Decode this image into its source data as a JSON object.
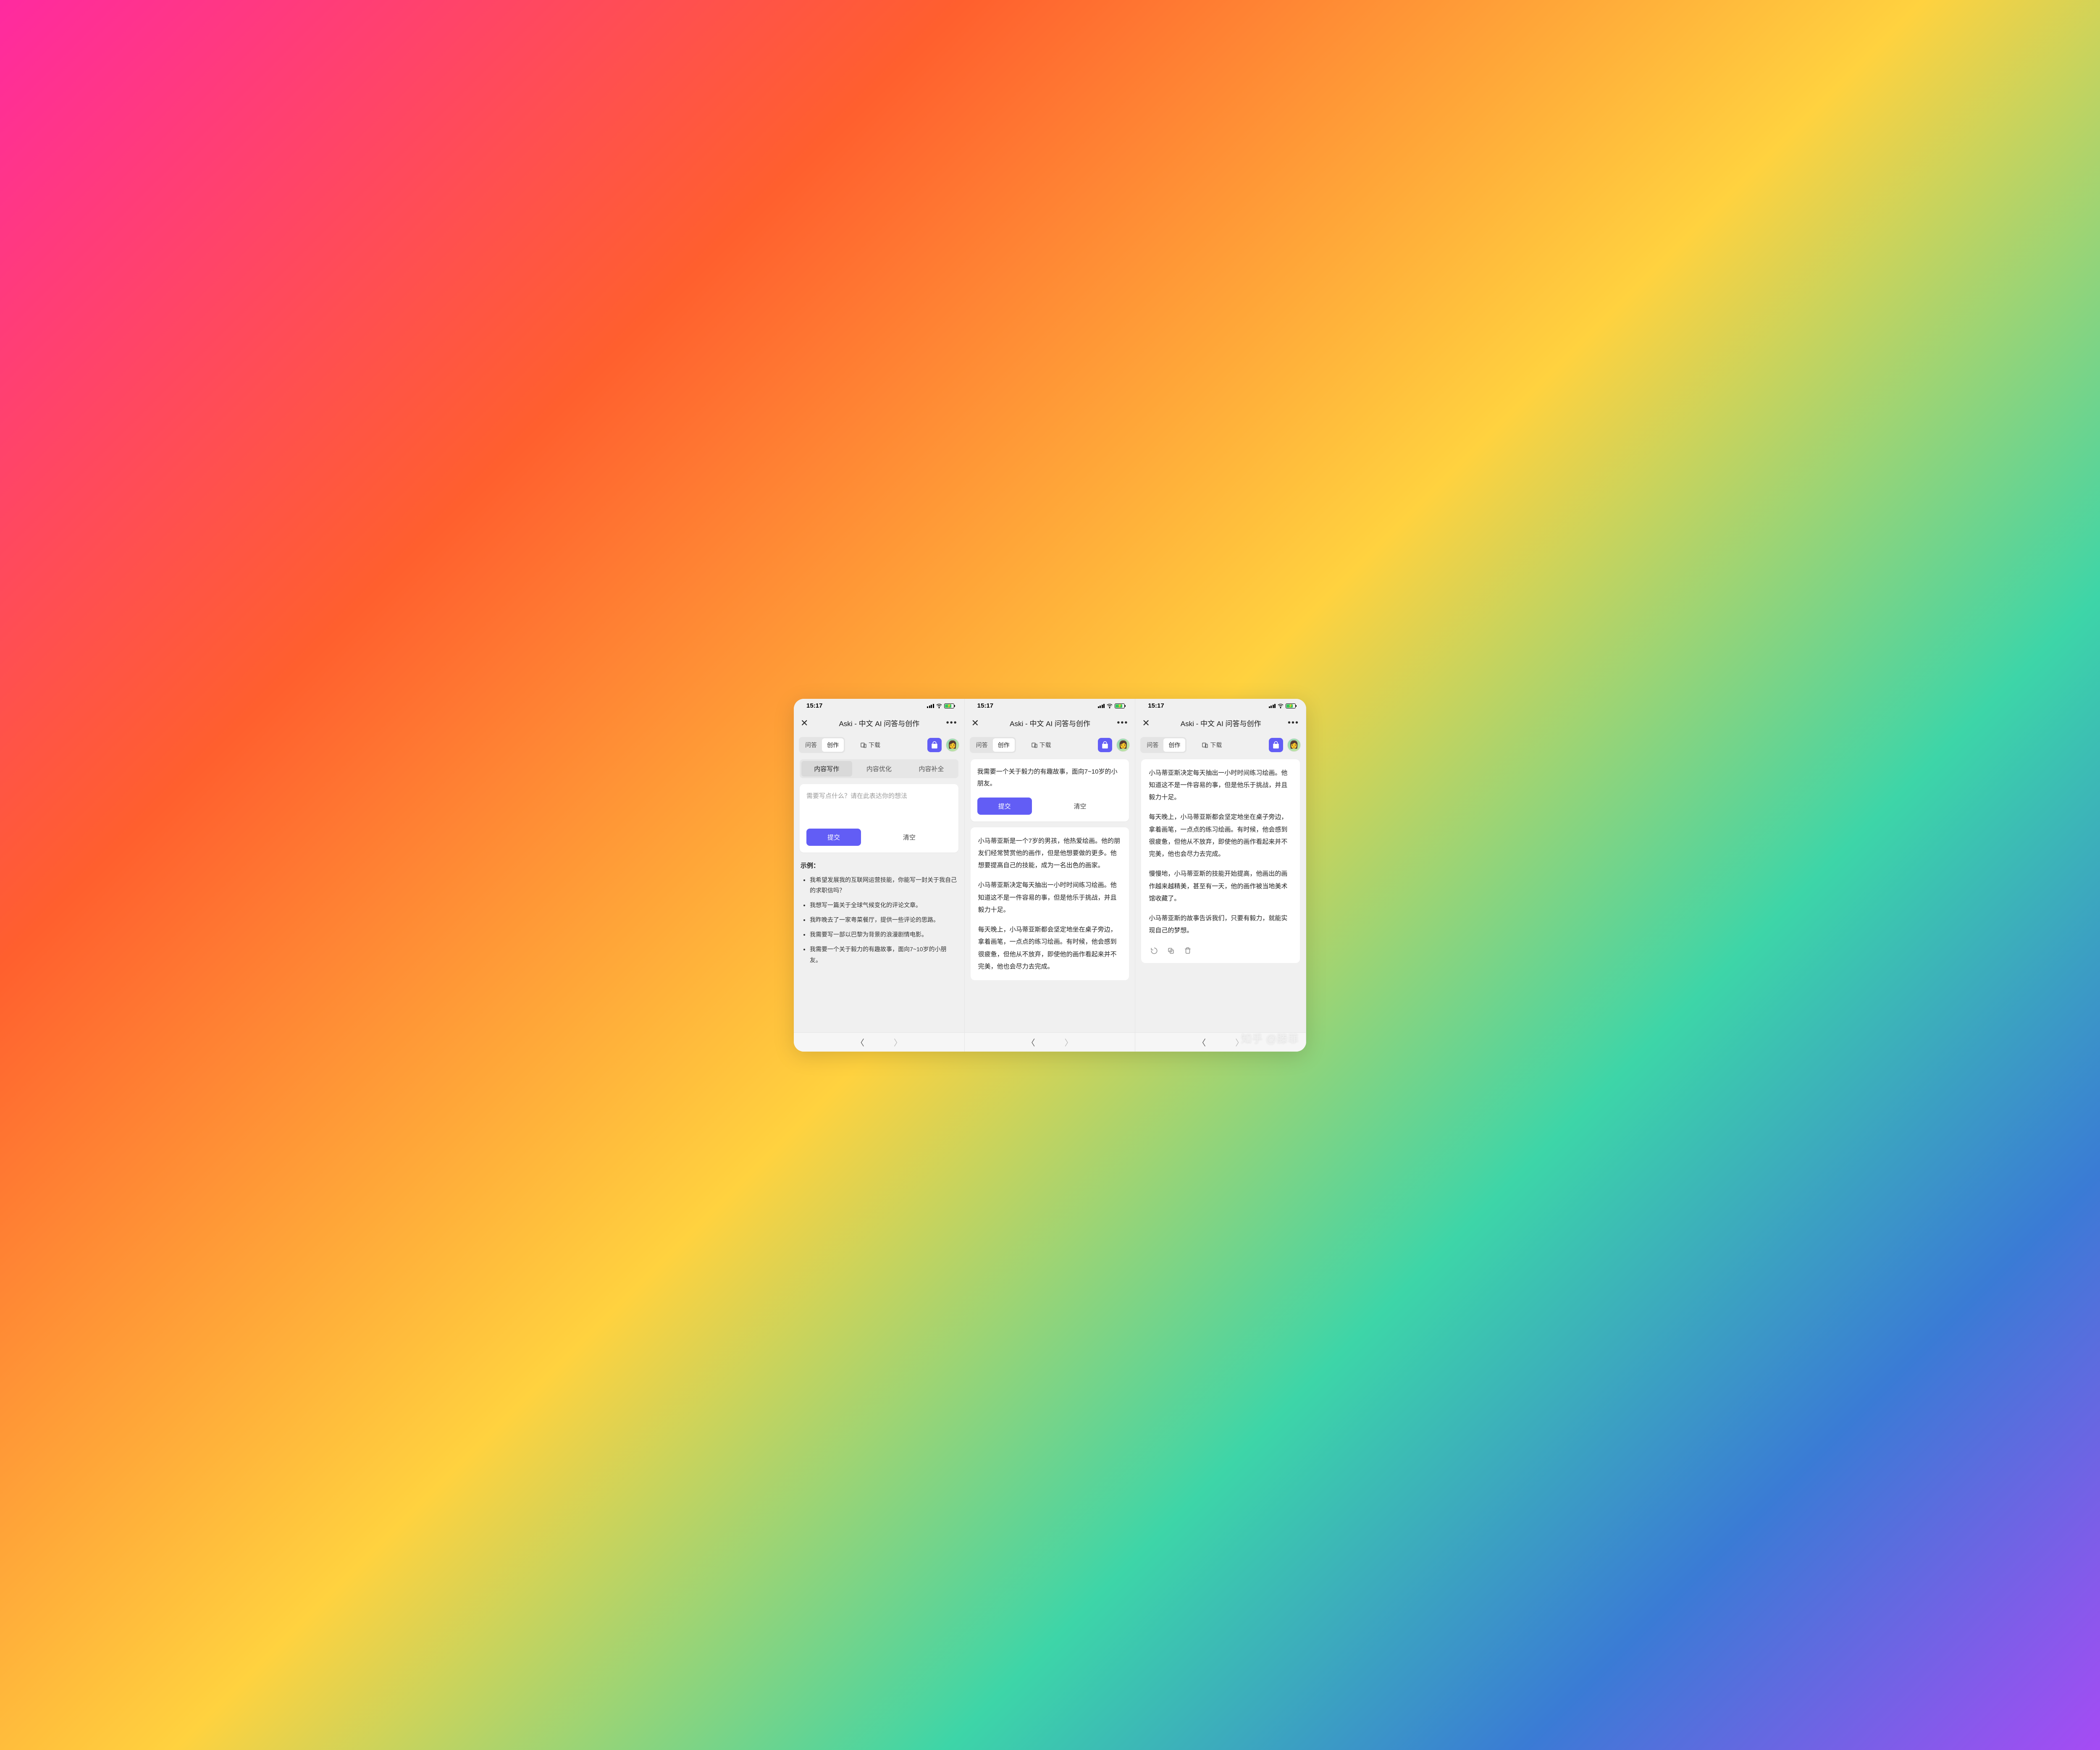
{
  "status": {
    "time": "15:17"
  },
  "navbar": {
    "title": "Aski - 中文 AI 问答与创作"
  },
  "toolbar": {
    "seg_qa": "问答",
    "seg_create": "创作",
    "download": "下载"
  },
  "subtabs": {
    "write": "内容写作",
    "improve": "内容优化",
    "complete": "内容补全"
  },
  "input": {
    "placeholder": "需要写点什么？请在此表达你的想法",
    "submit": "提交",
    "clear": "清空",
    "filled_prompt": "我需要一个关于毅力的有趣故事，面向7~10岁的小朋友。"
  },
  "examples": {
    "title": "示例：",
    "items": [
      "我希望发展我的互联网运营技能，你能写一封关于我自己的求职信吗？",
      "我想写一篇关于全球气候变化的评论文章。",
      "我昨晚去了一家粤菜餐厅，提供一些评论的思路。",
      "我需要写一部以巴黎为背景的浪漫剧情电影。",
      "我需要一个关于毅力的有趣故事，面向7~10岁的小朋友。"
    ]
  },
  "story": {
    "p1": "小马蒂亚斯是一个7岁的男孩，他热爱绘画。他的朋友们经常赞赏他的画作，但是他想要做的更多。他想要提高自己的技能，成为一名出色的画家。",
    "p2": "小马蒂亚斯决定每天抽出一小时时间练习绘画。他知道这不是一件容易的事，但是他乐于挑战，并且毅力十足。",
    "p3": "每天晚上，小马蒂亚斯都会坚定地坐在桌子旁边，拿着画笔，一点点的练习绘画。有时候，他会感到很疲惫，但他从不放弃，即使他的画作看起来并不完美，他也会尽力去完成。",
    "p4": "慢慢地，小马蒂亚斯的技能开始提高，他画出的画作越来越精美，甚至有一天，他的画作被当地美术馆收藏了。",
    "p5": "小马蒂亚斯的故事告诉我们，只要有毅力，就能实现自己的梦想。"
  },
  "watermark": "知乎 @滕菲"
}
